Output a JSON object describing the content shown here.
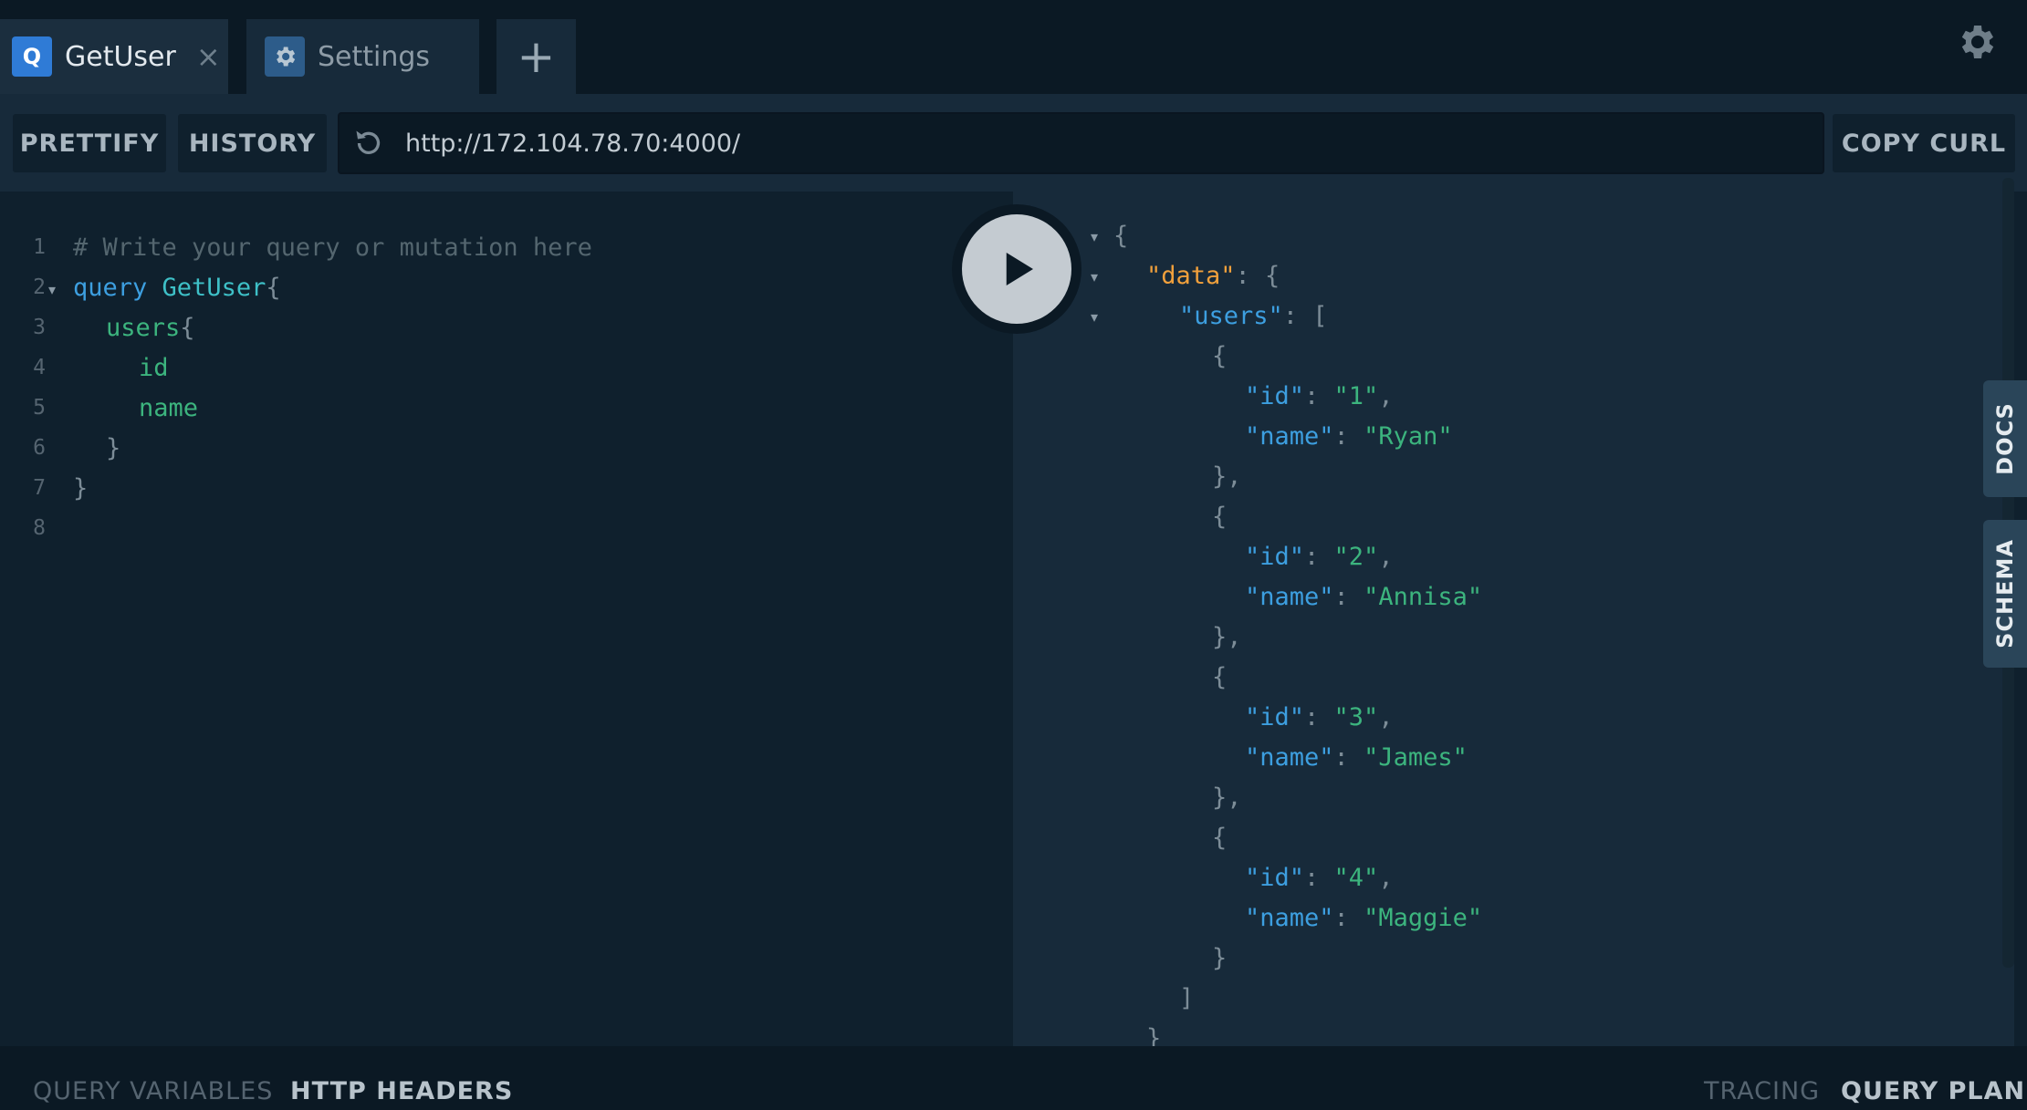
{
  "tabs": [
    {
      "badge": "Q",
      "label": "GetUser",
      "close": "×"
    },
    {
      "badge_icon": "gear-icon",
      "label": "Settings"
    }
  ],
  "add_tab_label": "+",
  "toolbar": {
    "prettify": "PRETTIFY",
    "history": "HISTORY",
    "url": "http://172.104.78.70:4000/",
    "copy_curl": "COPY CURL"
  },
  "editor": {
    "line_numbers": [
      "1",
      "2",
      "3",
      "4",
      "5",
      "6",
      "7",
      "8"
    ],
    "lines": {
      "l1": "# Write your query or mutation here",
      "l2_kw": "query",
      "l2_name": "GetUser",
      "l2_brace": "{",
      "l3_field": "users",
      "l3_brace": "{",
      "l4": "id",
      "l5": "name",
      "l6": "}",
      "l7": "}"
    }
  },
  "result": {
    "open_brace": "{",
    "data_key": "\"data\"",
    "users_key": "\"users\"",
    "users": [
      {
        "id": "\"1\"",
        "name": "\"Ryan\""
      },
      {
        "id": "\"2\"",
        "name": "\"Annisa\""
      },
      {
        "id": "\"3\"",
        "name": "\"James\""
      },
      {
        "id": "\"4\"",
        "name": "\"Maggie\""
      }
    ],
    "id_key": "\"id\"",
    "name_key": "\"name\""
  },
  "side_tabs": {
    "docs": "DOCS",
    "schema": "SCHEMA"
  },
  "bottom": {
    "query_variables": "QUERY VARIABLES",
    "http_headers": "HTTP HEADERS",
    "tracing": "TRACING",
    "query_plan": "QUERY PLAN"
  },
  "colors": {
    "accent_blue": "#2f7bd6",
    "settings_badge": "#2d5c8a",
    "json_key_orange": "#f0a03c"
  }
}
